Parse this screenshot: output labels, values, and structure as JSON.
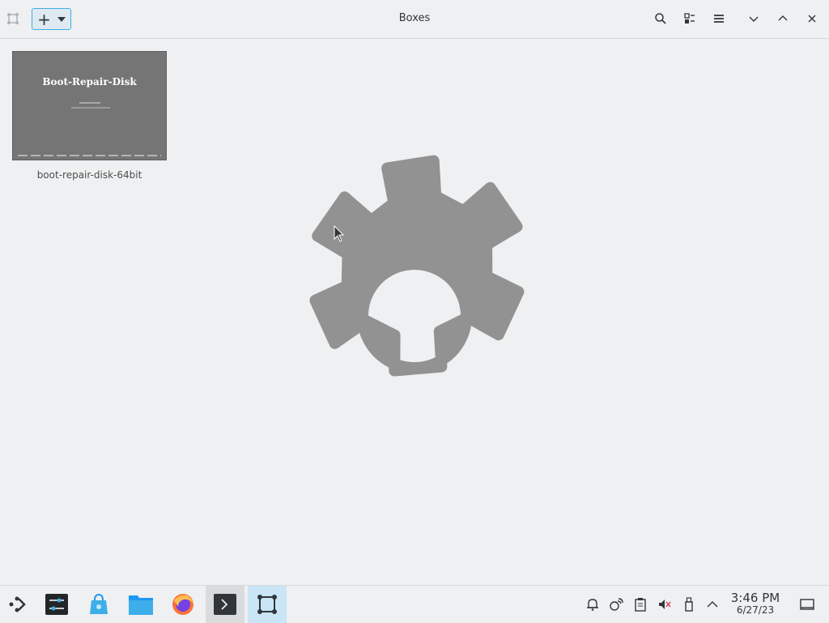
{
  "window": {
    "title": "Boxes",
    "new_button_label": "+"
  },
  "boxes": [
    {
      "name": "boot-repair-disk-64bit",
      "thumbnail_title": "Boot-Repair-Disk"
    }
  ],
  "toolbar_icons": [
    "search-icon",
    "selection-mode-icon",
    "hamburger-menu-icon"
  ],
  "window_controls": [
    "minimize-icon",
    "maximize-icon",
    "close-icon"
  ],
  "taskbar": {
    "apps": [
      "application-launcher-icon",
      "system-settings-icon",
      "discover-icon",
      "dolphin-icon",
      "firefox-icon",
      "konsole-icon",
      "boxes-icon"
    ],
    "clock": {
      "time": "3:46 PM",
      "date": "6/27/23"
    }
  },
  "colors": {
    "accent": "#3daee9",
    "gear": "#929292",
    "background": "#eff0f1"
  }
}
